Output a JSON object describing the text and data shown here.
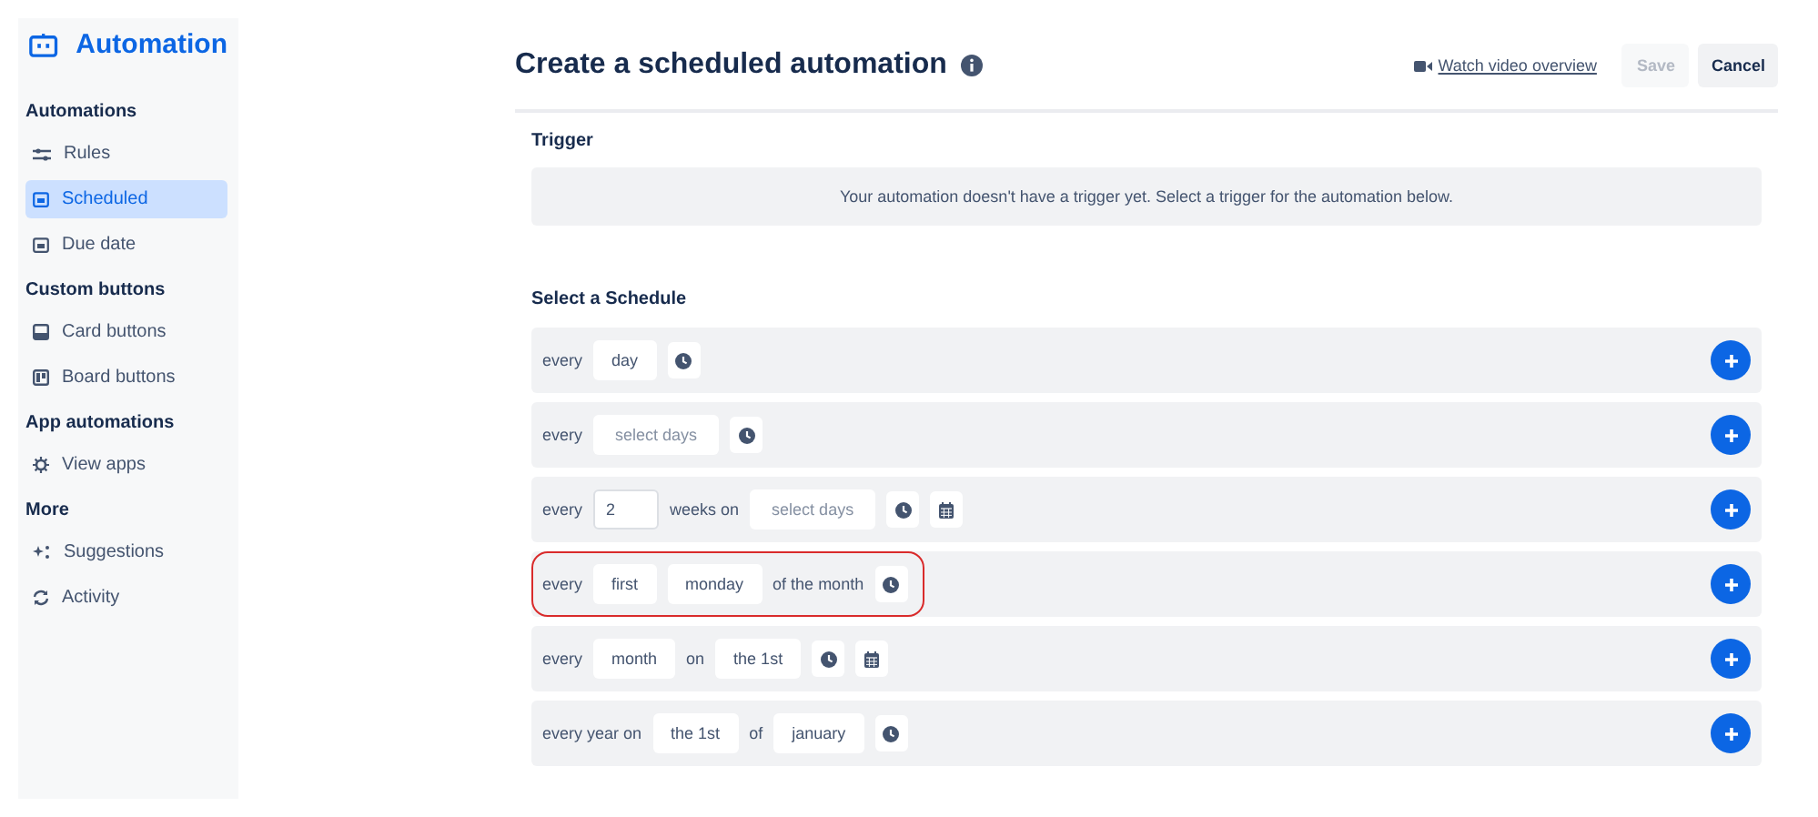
{
  "sidebar": {
    "title": "Automation",
    "sections": [
      {
        "heading": "Automations",
        "items": [
          {
            "label": "Rules",
            "selected": false
          },
          {
            "label": "Scheduled",
            "selected": true
          },
          {
            "label": "Due date",
            "selected": false
          }
        ]
      },
      {
        "heading": "Custom buttons",
        "items": [
          {
            "label": "Card buttons",
            "selected": false
          },
          {
            "label": "Board buttons",
            "selected": false
          }
        ]
      },
      {
        "heading": "App automations",
        "items": [
          {
            "label": "View apps",
            "selected": false
          }
        ]
      },
      {
        "heading": "More",
        "items": [
          {
            "label": "Suggestions",
            "selected": false
          },
          {
            "label": "Activity",
            "selected": false
          }
        ]
      }
    ]
  },
  "header": {
    "title": "Create a scheduled automation",
    "video_link": "Watch video overview",
    "buttons": [
      {
        "label": "Save",
        "disabled": true
      },
      {
        "label": "Cancel",
        "disabled": false
      }
    ]
  },
  "trigger": {
    "heading": "Trigger",
    "message": "Your automation doesn't have a trigger yet. Select a trigger for the automation below."
  },
  "schedule": {
    "heading": "Select a Schedule",
    "rows": [
      {
        "highlighted": false,
        "parts": [
          {
            "kind": "text",
            "text": "every"
          },
          {
            "kind": "select",
            "value": "day"
          },
          {
            "kind": "clock"
          }
        ]
      },
      {
        "highlighted": false,
        "parts": [
          {
            "kind": "text",
            "text": "every"
          },
          {
            "kind": "select",
            "placeholder": "select days"
          },
          {
            "kind": "clock"
          }
        ]
      },
      {
        "highlighted": false,
        "parts": [
          {
            "kind": "text",
            "text": "every"
          },
          {
            "kind": "input",
            "value": "2"
          },
          {
            "kind": "text",
            "text": "weeks on"
          },
          {
            "kind": "select",
            "placeholder": "select days"
          },
          {
            "kind": "clock"
          },
          {
            "kind": "calendar"
          }
        ]
      },
      {
        "highlighted": true,
        "parts": [
          {
            "kind": "text",
            "text": "every"
          },
          {
            "kind": "select",
            "value": "first"
          },
          {
            "kind": "select",
            "value": "monday"
          },
          {
            "kind": "text",
            "text": "of the month"
          },
          {
            "kind": "clock"
          }
        ]
      },
      {
        "highlighted": false,
        "parts": [
          {
            "kind": "text",
            "text": "every"
          },
          {
            "kind": "select",
            "value": "month"
          },
          {
            "kind": "text",
            "text": "on"
          },
          {
            "kind": "select",
            "value": "the 1st"
          },
          {
            "kind": "clock"
          },
          {
            "kind": "calendar"
          }
        ]
      },
      {
        "highlighted": false,
        "parts": [
          {
            "kind": "text",
            "text": "every year on"
          },
          {
            "kind": "select",
            "value": "the 1st"
          },
          {
            "kind": "text",
            "text": "of"
          },
          {
            "kind": "select",
            "value": "january"
          },
          {
            "kind": "clock"
          }
        ]
      }
    ]
  }
}
